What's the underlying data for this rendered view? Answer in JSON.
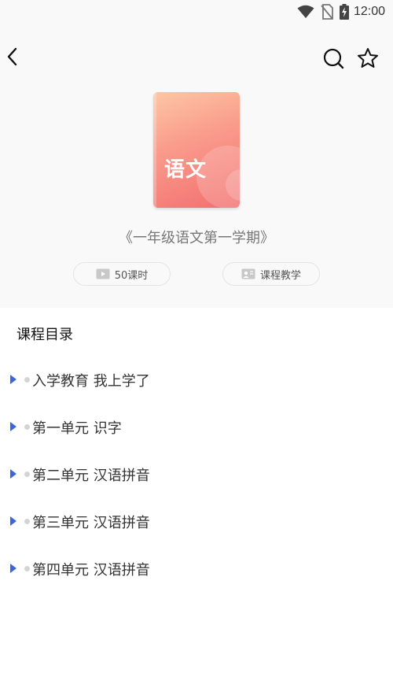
{
  "status_bar": {
    "time": "12:00",
    "icons": [
      "wifi-icon",
      "no-sim-icon",
      "battery-charging-icon"
    ]
  },
  "header": {
    "back_icon": "back-arrow-icon",
    "search_icon": "search-icon",
    "favorite_icon": "star-icon"
  },
  "book": {
    "cover_title": "语文",
    "name": "《一年级语文第一学期》"
  },
  "tags": {
    "lessons": "50课时",
    "teaching": "课程教学"
  },
  "catalog": {
    "title": "课程目录",
    "items": [
      {
        "label": "入学教育 我上学了"
      },
      {
        "label": "第一单元 识字"
      },
      {
        "label": "第二单元 汉语拼音"
      },
      {
        "label": "第三单元 汉语拼音"
      },
      {
        "label": "第四单元 汉语拼音"
      }
    ]
  },
  "colors": {
    "accent_arrow": "#3a66d9",
    "panel_bg": "#f9f9f9",
    "cover_gradient_top": "#fdc7a4",
    "cover_gradient_bottom": "#f26f6f"
  }
}
